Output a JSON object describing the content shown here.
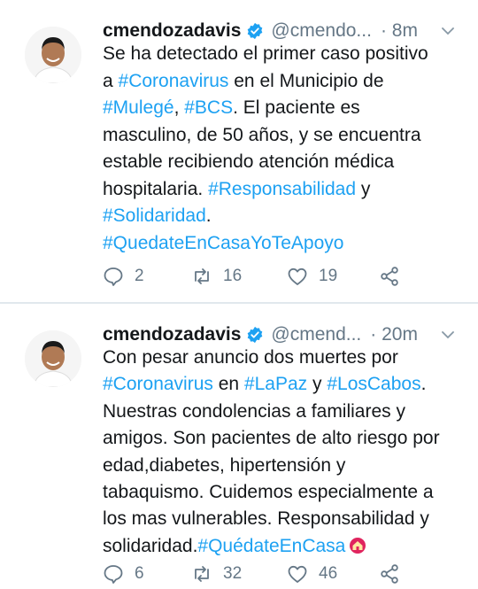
{
  "tweets": [
    {
      "name": "cmendozadavis",
      "handle": "@cmendo...",
      "time": "· 8m",
      "lines": [
        [
          {
            "t": "Se ha detectado el primer caso positivo"
          }
        ],
        [
          {
            "t": "a "
          },
          {
            "t": "#Coronavirus",
            "tag": true
          },
          {
            "t": " en el Municipio de"
          }
        ],
        [
          {
            "t": "#Mulegé",
            "tag": true
          },
          {
            "t": ", "
          },
          {
            "t": "#BCS",
            "tag": true
          },
          {
            "t": ". El paciente es"
          }
        ],
        [
          {
            "t": "masculino, de 50 años, y se encuentra"
          }
        ],
        [
          {
            "t": "estable recibiendo atención médica"
          }
        ],
        [
          {
            "t": "hospitalaria. "
          },
          {
            "t": "#Responsabilidad",
            "tag": true
          },
          {
            "t": " y"
          }
        ],
        [
          {
            "t": "#Solidaridad",
            "tag": true
          },
          {
            "t": "."
          }
        ],
        [
          {
            "t": "#QuedateEnCasaYoTeApoyo",
            "tag": true
          }
        ]
      ],
      "replies": "2",
      "retweets": "16",
      "likes": "19"
    },
    {
      "name": "cmendozadavis",
      "handle": "@cmend...",
      "time": "· 20m",
      "lines": [
        [
          {
            "t": "Con pesar anuncio dos muertes por"
          }
        ],
        [
          {
            "t": "#Coronavirus",
            "tag": true
          },
          {
            "t": " en "
          },
          {
            "t": "#LaPaz",
            "tag": true
          },
          {
            "t": " y "
          },
          {
            "t": "#LosCabos",
            "tag": true
          },
          {
            "t": "."
          }
        ],
        [
          {
            "t": "Nuestras condolencias a familiares y"
          }
        ],
        [
          {
            "t": "amigos. Son pacientes de alto riesgo por"
          }
        ],
        [
          {
            "t": "edad,diabetes, hipertensión y"
          }
        ],
        [
          {
            "t": "tabaquismo. Cuidemos especialmente a"
          }
        ],
        [
          {
            "t": "los mas vulnerables. Responsabilidad y"
          }
        ],
        [
          {
            "t": "solidaridad."
          },
          {
            "t": "#QuédateEnCasa",
            "tag": true
          },
          {
            "emoji": "house-with-garden-icon"
          }
        ]
      ],
      "replies": "6",
      "retweets": "32",
      "likes": "46"
    }
  ],
  "colors": {
    "link": "#1da1f2",
    "muted": "#657786",
    "text": "#14171a",
    "verified": "#1da1f2"
  },
  "icons": [
    "verified-badge-icon",
    "chevron-down-icon",
    "reply-icon",
    "retweet-icon",
    "like-icon",
    "share-icon"
  ]
}
